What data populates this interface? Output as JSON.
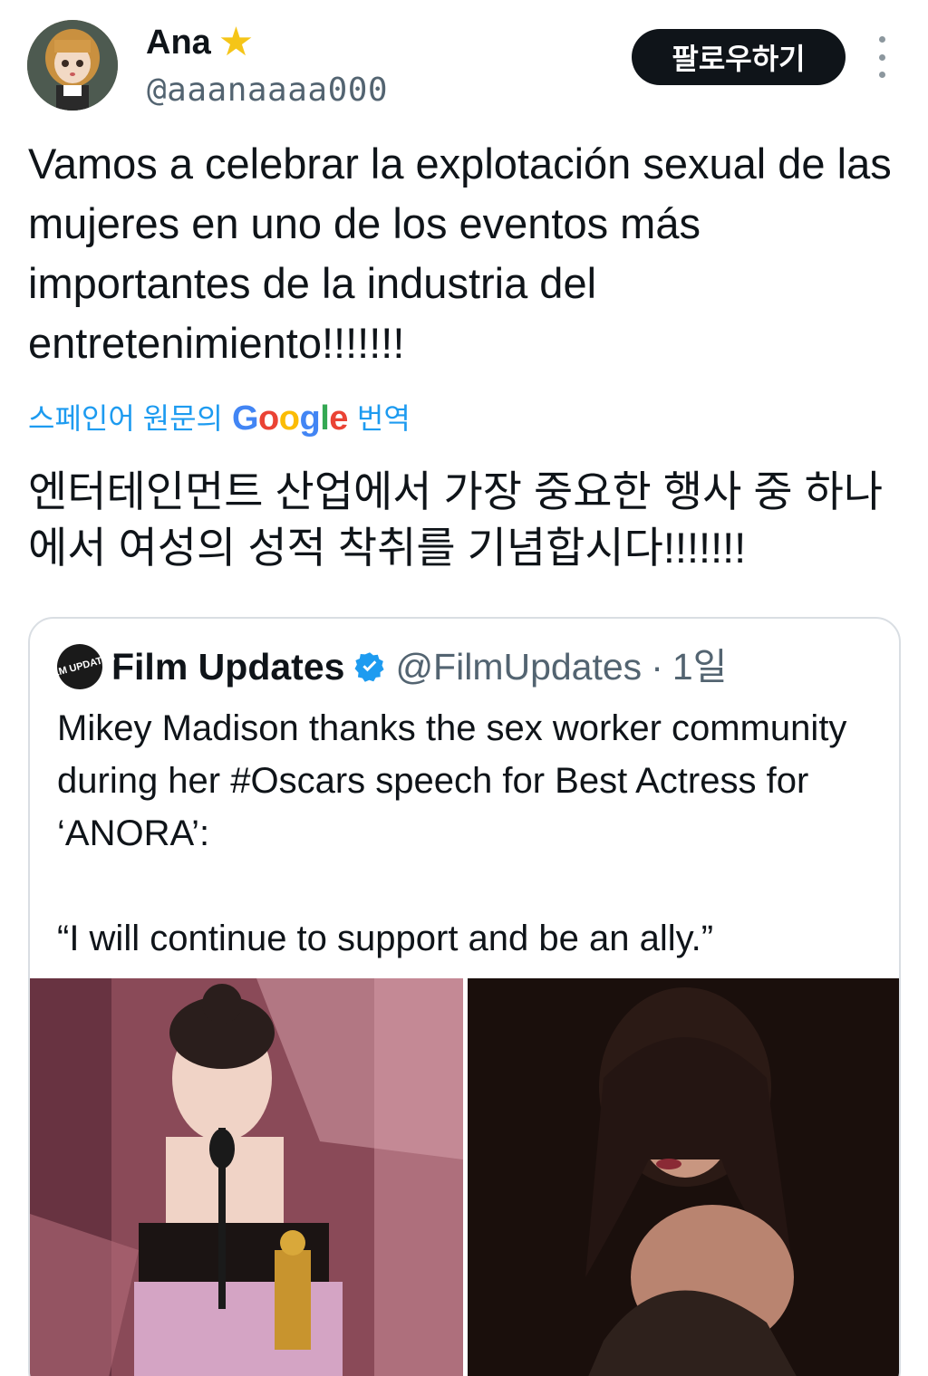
{
  "author": {
    "display_name": "Ana",
    "badge_icon": "star-icon",
    "handle": "@aaanaaaa000"
  },
  "actions": {
    "follow_label": "팔로우하기",
    "more_icon": "more-vertical-icon"
  },
  "tweet": {
    "text": "Vamos a celebrar la explotación sexual de las mujeres en uno de los eventos más importantes de la industria del entretenimiento!!!!!!!",
    "translate_prefix": "스페인어 원문의",
    "translate_brand": "Google",
    "translate_suffix": "번역",
    "translated_text": "엔터테인먼트 산업에서 가장 중요한 행사 중 하나에서 여성의 성적 착취를 기념합시다!!!!!!!"
  },
  "quote": {
    "avatar_text": "FILM UPDATES",
    "name": "Film Updates",
    "verified_icon": "verified-badge-icon",
    "handle": "@FilmUpdates",
    "separator": "·",
    "time": "1일",
    "text": "Mikey Madison thanks the sex worker community during her #Oscars speech for Best Actress for ‘ANORA’:\n\n“I will continue to support and be an ally.”",
    "media": [
      {
        "name": "oscars-speech-photo"
      },
      {
        "name": "portrait-photo"
      }
    ]
  },
  "colors": {
    "link": "#1d9bf0",
    "secondary_text": "#536471",
    "follow_bg": "#0f1419",
    "verified": "#1d9bf0"
  }
}
